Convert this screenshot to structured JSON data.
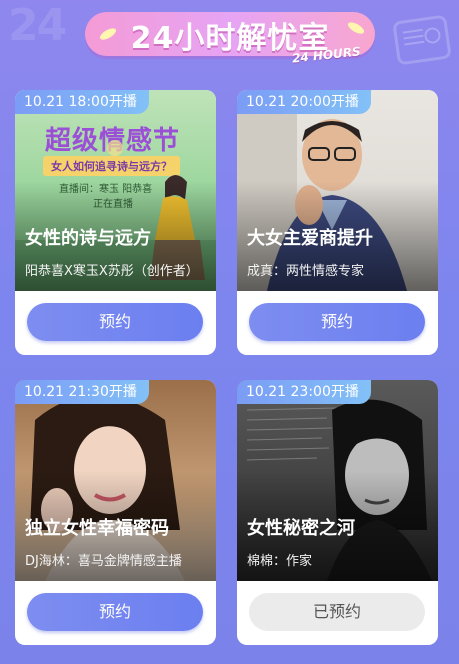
{
  "header": {
    "title": "24小时解忧室",
    "subtitle": "24 HOURS"
  },
  "cards": [
    {
      "time": "10.21 18:00开播",
      "title": "女性的诗与远方",
      "subtitle": "阳恭喜X寒玉X苏彤（创作者）",
      "button": "预约",
      "booked": false,
      "poster": {
        "heading": "超级情感节",
        "ribbon": "女人如何追寻诗与远方？",
        "line1": "直播间：寒玉 阳恭喜",
        "line2": "正在直播"
      }
    },
    {
      "time": "10.21 20:00开播",
      "title": "大女主爱商提升",
      "subtitle": "成真：两性情感专家",
      "button": "预约",
      "booked": false
    },
    {
      "time": "10.21 21:30开播",
      "title": "独立女性幸福密码",
      "subtitle": "DJ海林：喜马金牌情感主播",
      "button": "预约",
      "booked": false
    },
    {
      "time": "10.21 23:00开播",
      "title": "女性秘密之河",
      "subtitle": "棉棉：作家",
      "button": "已预约",
      "booked": true
    }
  ],
  "colors": {
    "background": "#8a88ee",
    "button": "#7284f0",
    "badge": "#7fb0f6"
  }
}
